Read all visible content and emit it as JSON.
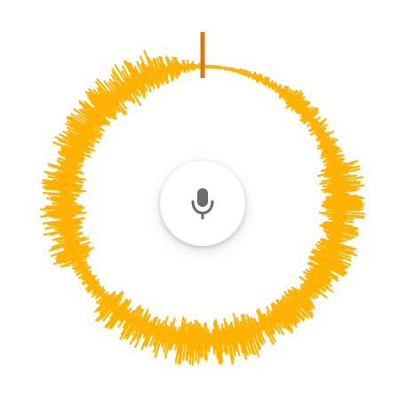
{
  "recorder": {
    "waveform_color": "#FFB300",
    "playhead_color": "#E07700",
    "ring_line_color": "#FFB300",
    "progress": 0.01,
    "button": {
      "icon": "microphone-icon",
      "icon_color": "#6b6b6b",
      "background": "#ffffff"
    }
  }
}
